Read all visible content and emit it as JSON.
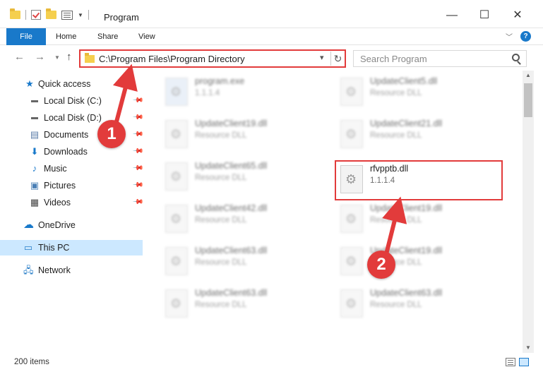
{
  "window": {
    "title": "Program",
    "minimize": "—",
    "maximize": "☐",
    "close": "✕"
  },
  "ribbon": {
    "tabs": [
      "File",
      "Home",
      "Share",
      "View"
    ],
    "help": "?"
  },
  "address": {
    "path": "C:\\Program Files\\Program Directory",
    "search_placeholder": "Search Program"
  },
  "nav": {
    "items": [
      {
        "label": "Quick access",
        "icon": "star-icon",
        "pinned": false
      },
      {
        "label": "Local Disk (C:)",
        "icon": "drive-icon",
        "pinned": true
      },
      {
        "label": "Local Disk (D:)",
        "icon": "drive-icon",
        "pinned": true
      },
      {
        "label": "Documents",
        "icon": "documents-icon",
        "pinned": true
      },
      {
        "label": "Downloads",
        "icon": "download-icon",
        "pinned": true
      },
      {
        "label": "Music",
        "icon": "music-icon",
        "pinned": true
      },
      {
        "label": "Pictures",
        "icon": "pictures-icon",
        "pinned": true
      },
      {
        "label": "Videos",
        "icon": "videos-icon",
        "pinned": true
      },
      {
        "label": "OneDrive",
        "icon": "cloud-icon",
        "pinned": false
      },
      {
        "label": "This PC",
        "icon": "computer-icon",
        "pinned": false,
        "selected": true
      },
      {
        "label": "Network",
        "icon": "network-icon",
        "pinned": false
      }
    ]
  },
  "files": {
    "col1": [
      {
        "name": "program.exe",
        "sub": "1.1.1.4"
      },
      {
        "name": "UpdateClient19.dll",
        "sub": "Resource DLL"
      },
      {
        "name": "UpdateClient65.dll",
        "sub": "Resource DLL"
      },
      {
        "name": "UpdateClient42.dll",
        "sub": "Resource DLL"
      },
      {
        "name": "UpdateClient63.dll",
        "sub": "Resource DLL"
      },
      {
        "name": "UpdateClient63.dll",
        "sub": "Resource DLL"
      }
    ],
    "col2": [
      {
        "name": "UpdateClient5.dll",
        "sub": "Resource DLL"
      },
      {
        "name": "UpdateClient21.dll",
        "sub": "Resource DLL"
      },
      {
        "name": "rfvpptb.dll",
        "sub": "1.1.1.4"
      },
      {
        "name": "UpdateClient19.dll",
        "sub": "Resource DLL"
      },
      {
        "name": "UpdateClient19.dll",
        "sub": "Resource DLL"
      },
      {
        "name": "UpdateClient63.dll",
        "sub": "Resource DLL"
      }
    ]
  },
  "status": {
    "count": "200 items"
  },
  "annotations": {
    "step1": "1",
    "step2": "2"
  },
  "colors": {
    "accent": "#1979ca",
    "annotation_red": "#e23b3b",
    "selection": "#cce8ff"
  }
}
